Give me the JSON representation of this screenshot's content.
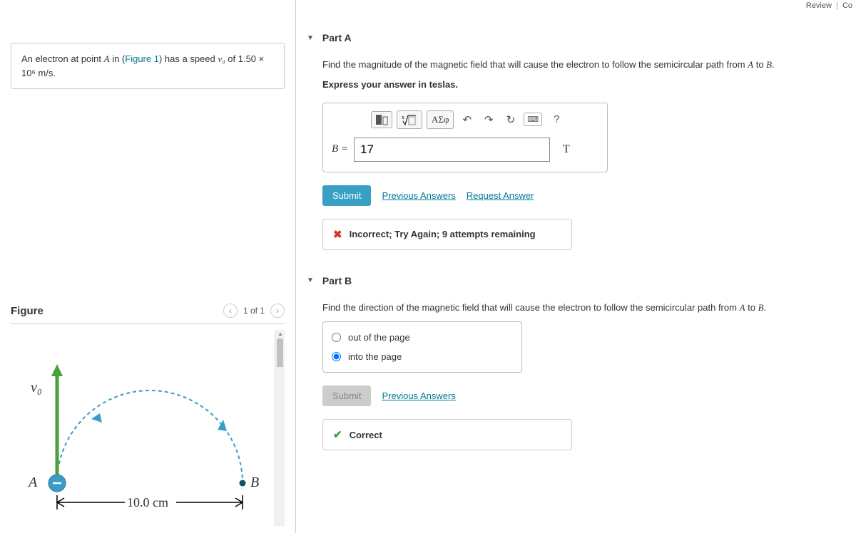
{
  "topbar": {
    "review": "Review",
    "co": "Co"
  },
  "problem": {
    "prefix": "An electron at point ",
    "A": "A",
    "mid1": " in (",
    "figlink": "Figure 1",
    "mid2": ") has a speed ",
    "v0": "v₀",
    "mid3": " of ",
    "speed": "1.50 × 10⁶ m/s",
    "end": "."
  },
  "figure": {
    "title": "Figure",
    "counter": "1 of 1",
    "v0_label": "v₀",
    "A_label": "A",
    "B_label": "B",
    "dim": "10.0 cm"
  },
  "partA": {
    "title": "Part A",
    "question": "Find the magnitude of the magnetic field that will cause the electron to follow the semicircular path from A to B.",
    "instruction": "Express your answer in teslas.",
    "toolbar": {
      "templates": "ΑΣφ",
      "help": "?"
    },
    "eq_lhs": "B =",
    "value": "17",
    "unit": "T",
    "submit": "Submit",
    "prev_answers": "Previous Answers",
    "request": "Request Answer",
    "feedback": "Incorrect; Try Again; 9 attempts remaining"
  },
  "partB": {
    "title": "Part B",
    "question": "Find the direction of the magnetic field that will cause the electron to follow the semicircular path from A to B.",
    "options": {
      "out": "out of the page",
      "into": "into the page"
    },
    "selected": "into",
    "submit": "Submit",
    "prev_answers": "Previous Answers",
    "feedback": "Correct"
  }
}
